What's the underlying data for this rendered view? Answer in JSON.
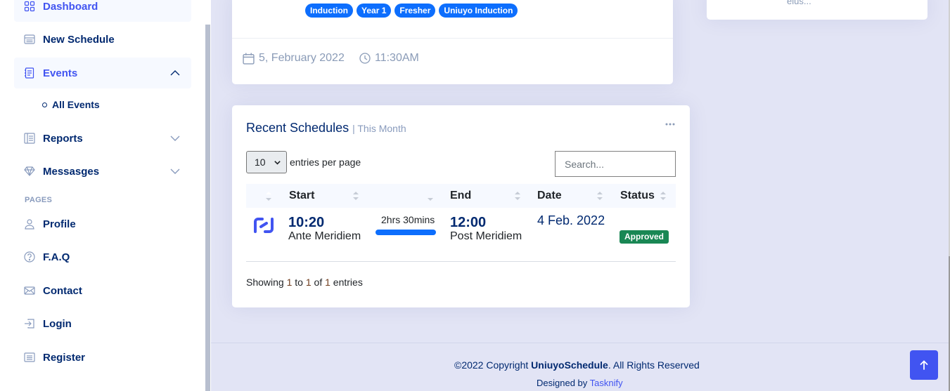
{
  "sidebar": {
    "items": [
      {
        "label": "Dashboard",
        "icon": "grid-icon"
      },
      {
        "label": "New Schedule",
        "icon": "menu-button-icon"
      },
      {
        "label": "Events",
        "icon": "journal-text-icon",
        "expanded": true
      },
      {
        "label": "Reports",
        "icon": "layout-text-icon"
      },
      {
        "label": "Messasges",
        "icon": "gem-icon"
      }
    ],
    "sub_items": [
      {
        "label": "All Events"
      }
    ],
    "section_heading": "PAGES",
    "pages": [
      {
        "label": "Profile",
        "icon": "person-icon"
      },
      {
        "label": "F.A.Q",
        "icon": "question-circle-icon"
      },
      {
        "label": "Contact",
        "icon": "envelope-icon"
      },
      {
        "label": "Login",
        "icon": "box-arrow-in-right-icon"
      },
      {
        "label": "Register",
        "icon": "card-list-icon"
      }
    ]
  },
  "event_card": {
    "tags": [
      "Induction",
      "Year 1",
      "Fresher",
      "Uniuyo Induction"
    ],
    "date": "5, February 2022",
    "time": "11:30AM"
  },
  "side_card": {
    "truncated_text": "eius..."
  },
  "schedules": {
    "title": "Recent Schedules",
    "subtitle": "| This Month",
    "more_icon": "three-dots-icon",
    "per_page_value": "10",
    "per_page_label": "entries per page",
    "search_placeholder": "Search...",
    "columns": [
      "",
      "Start",
      "",
      "End",
      "Date",
      "Status"
    ],
    "rows": [
      {
        "start_time": "10:20",
        "start_meridiem": "Ante Meridiem",
        "duration": "2hrs 30mins",
        "end_time": "12:00",
        "end_meridiem": "Post Meridiem",
        "date": "4 Feb. 2022",
        "status": "Approved"
      }
    ],
    "showing": {
      "prefix": "Showing ",
      "from": "1",
      "mid1": " to ",
      "to": "1",
      "mid2": " of ",
      "total": "1",
      "suffix": " entries"
    }
  },
  "footer": {
    "copyright_prefix": "©2022 Copyright ",
    "brand": "UniuyoSchedule",
    "copyright_suffix": ". All Rights Reserved",
    "designed_by": "Designed by ",
    "designer": "Tasknify"
  },
  "colors": {
    "accent": "#4154f1",
    "badge": "#0d6efd",
    "approved": "#198754",
    "navy": "#012970"
  }
}
